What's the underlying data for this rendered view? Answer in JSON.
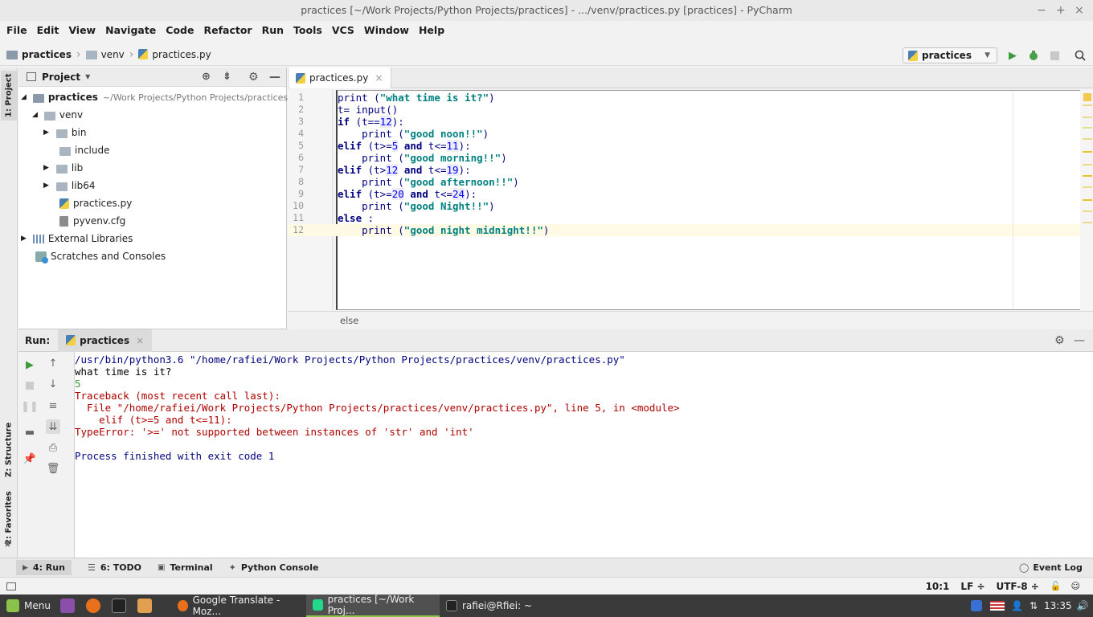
{
  "window": {
    "title": "practices [~/Work Projects/Python Projects/practices] - .../venv/practices.py [practices] - PyCharm",
    "min": "−",
    "max": "+",
    "close": "×"
  },
  "menu": [
    "File",
    "Edit",
    "View",
    "Navigate",
    "Code",
    "Refactor",
    "Run",
    "Tools",
    "VCS",
    "Window",
    "Help"
  ],
  "breadcrumbs": [
    "practices",
    "venv",
    "practices.py"
  ],
  "run_config": "practices",
  "left_tool_tabs": {
    "project": "1: Project",
    "structure": "Z: Structure",
    "favorites": "2: Favorites"
  },
  "project_panel": {
    "title": "Project",
    "root": {
      "name": "practices",
      "path": "~/Work Projects/Python Projects/practices"
    },
    "items": [
      "venv",
      "bin",
      "include",
      "lib",
      "lib64",
      "practices.py",
      "pyvenv.cfg",
      "External Libraries",
      "Scratches and Consoles"
    ]
  },
  "editor": {
    "tab": "practices.py",
    "line_numbers": [
      "1",
      "2",
      "3",
      "4",
      "5",
      "6",
      "7",
      "8",
      "9",
      "10",
      "11",
      "12"
    ],
    "breadcrumb": "else"
  },
  "run_panel": {
    "label": "Run:",
    "tab": "practices"
  },
  "console": {
    "lines": [
      "/usr/bin/python3.6 \"/home/rafiei/Work Projects/Python Projects/practices/venv/practices.py\"",
      "what time is it?",
      "5",
      "Traceback (most recent call last):",
      "  File \"/home/rafiei/Work Projects/Python Projects/practices/venv/practices.py\", line 5, in <module>",
      "    elif (t>=5 and t<=11):",
      "TypeError: '>=' not supported between instances of 'str' and 'int'",
      "",
      "Process finished with exit code 1"
    ]
  },
  "bottom_tabs": [
    "4: Run",
    "6: TODO",
    "Terminal",
    "Python Console"
  ],
  "event_log": "Event Log",
  "status": {
    "position": "10:1",
    "line_sep": "LF ÷",
    "encoding": "UTF-8 ÷"
  },
  "taskbar": {
    "menu": "Menu",
    "windows": [
      "Google Translate - Moz...",
      "practices [~/Work Proj...",
      "rafiei@Rfiei: ~"
    ],
    "clock": "13:35"
  }
}
